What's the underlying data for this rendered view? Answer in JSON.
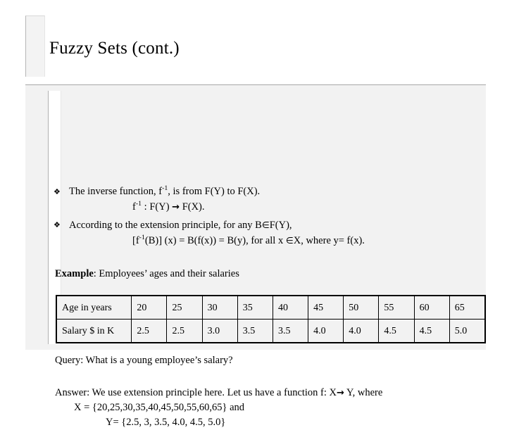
{
  "slide": {
    "title": "Fuzzy Sets (cont.)",
    "bullet_glyph": "❖",
    "bullets": [
      {
        "text_before": "The inverse function, f",
        "sup": "-1",
        "text_after": ", is from F(Y) to F(X)."
      },
      {
        "text_before": "According to the extension principle, for any B",
        "elem": "∈",
        "text_after": "F(Y),"
      }
    ],
    "formulas": [
      {
        "prefix": "f",
        "sup": "-1",
        "mid": " : F(Y) ",
        "arrow": "→",
        "suffix": " F(X)."
      },
      {
        "prefix": "[f",
        "sup": "-1",
        "mid": "(B)] (x) = B(f(x)) = B(y), for all x ",
        "elem": "∈",
        "suffix": "X, where y= f(x)."
      }
    ],
    "example": {
      "label": "Example",
      "text": ": Employees’ ages and their salaries"
    },
    "table": {
      "rows": [
        {
          "label": "Age in years",
          "cells": [
            "20",
            "25",
            "30",
            "35",
            "40",
            "45",
            "50",
            "55",
            "60",
            "65"
          ]
        },
        {
          "label": "Salary $ in K",
          "cells": [
            "2.5",
            "2.5",
            "3.0",
            "3.5",
            "3.5",
            "4.0",
            "4.0",
            "4.5",
            "4.5",
            "5.0"
          ]
        }
      ]
    },
    "query": "Query: What is a young employee’s salary?",
    "answer": {
      "line1_before": "Answer: We use extension principle here. Let us have a function f: X",
      "arrow": "→",
      "line1_after": " Y, where",
      "line2": "X = {20,25,30,35,40,45,50,55,60,65} and",
      "line3": "Y= {2.5, 3, 3.5, 4.0, 4.5, 5.0}"
    }
  }
}
